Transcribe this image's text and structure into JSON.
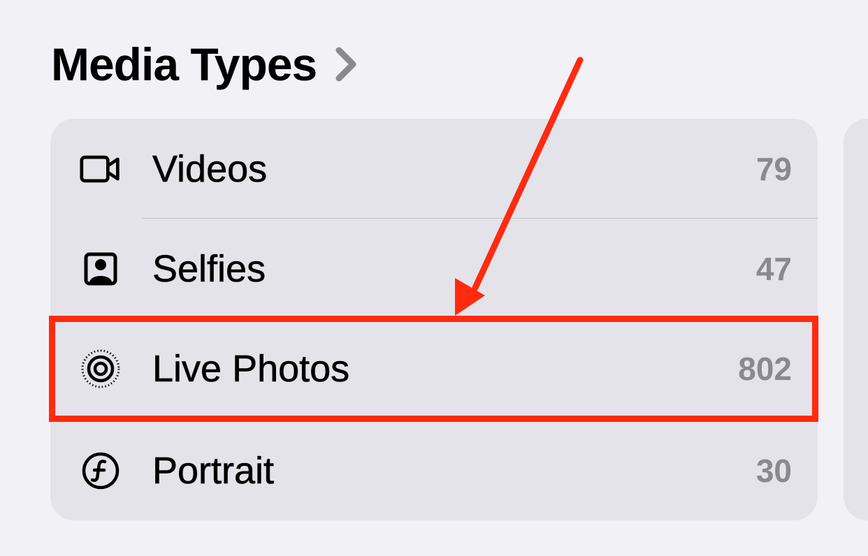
{
  "section": {
    "title": "Media Types"
  },
  "rows": [
    {
      "label": "Videos",
      "count": "79",
      "icon": "video-camera-icon"
    },
    {
      "label": "Selfies",
      "count": "47",
      "icon": "selfie-portrait-frame-icon"
    },
    {
      "label": "Live Photos",
      "count": "802",
      "icon": "live-photo-icon"
    },
    {
      "label": "Portrait",
      "count": "30",
      "icon": "portrait-f-circle-icon"
    }
  ],
  "annotation": {
    "highlighted_row": "Live Photos",
    "color": "#ff2a0f"
  },
  "colors": {
    "background": "#f2f1f6",
    "card": "#e4e3e9",
    "count_text": "#8a8a8e",
    "chevron": "#8a8a8e"
  }
}
